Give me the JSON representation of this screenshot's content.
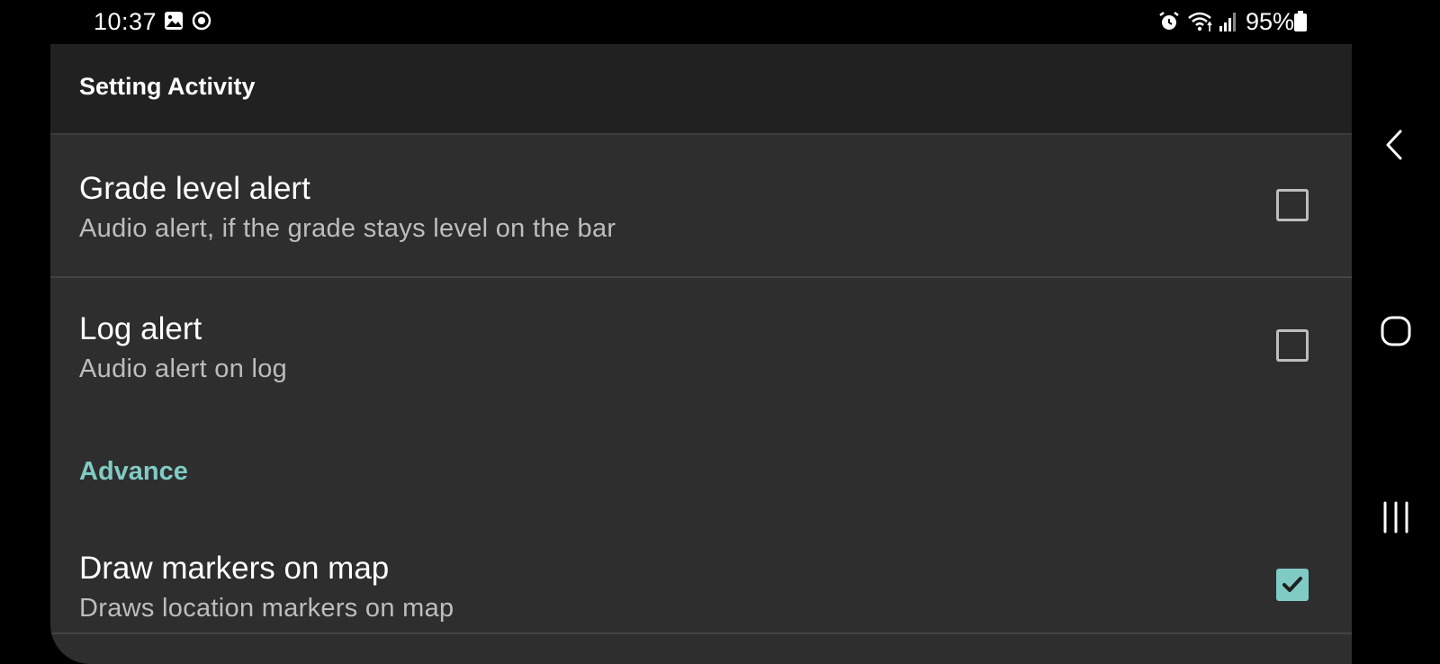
{
  "status_bar": {
    "time": "10:37",
    "left_icons": [
      "gallery-icon",
      "sync-icon"
    ],
    "right_icons": [
      "alarm-icon",
      "wifi-icon",
      "signal-icon",
      "battery-icon"
    ],
    "battery": "95%"
  },
  "app_bar": {
    "title": "Setting Activity"
  },
  "preferences": [
    {
      "title": "Grade level alert",
      "summary": "Audio alert, if the grade stays level on the bar",
      "checked": false
    },
    {
      "title": "Log alert",
      "summary": "Audio alert on log",
      "checked": false
    }
  ],
  "category": {
    "title": "Advance"
  },
  "advanced_preferences": [
    {
      "title": "Draw markers on map",
      "summary": "Draws location markers on map",
      "checked": true
    }
  ],
  "nav_bar": {
    "buttons": [
      "back-icon",
      "home-icon",
      "recents-icon"
    ]
  },
  "colors": {
    "accent": "#80cbc4",
    "background": "#2e2e2e",
    "app_bar": "#212121"
  }
}
